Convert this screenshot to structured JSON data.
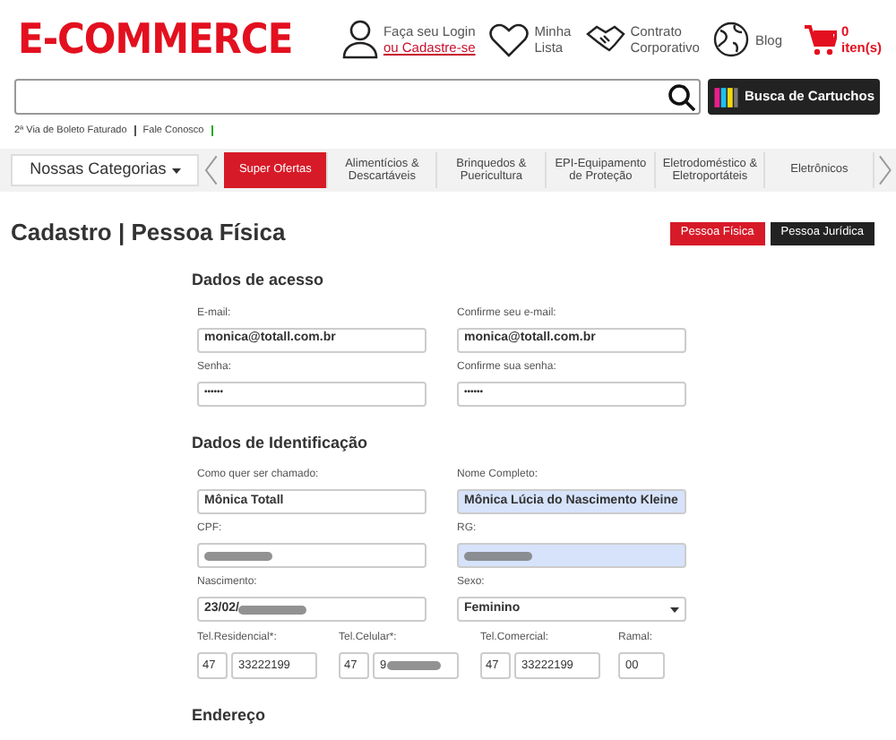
{
  "header": {
    "logo": "E-COMMERCE",
    "links": [
      {
        "kind": "login",
        "line1": "Faça seu Login",
        "line2": "ou Cadastre-se"
      },
      {
        "kind": "wishlist",
        "line1": "Minha",
        "line2": "Lista"
      },
      {
        "kind": "contract",
        "line1": "Contrato",
        "line2": "Corporativo"
      },
      {
        "kind": "blog",
        "line1": "Blog"
      }
    ],
    "cart": {
      "count": "0",
      "label": "iten(s)"
    }
  },
  "search": {
    "button": "Busca de Cartuchos"
  },
  "top_links": [
    "2ª Via de Boleto Faturado",
    "Fale Conosco"
  ],
  "nav": {
    "categories_button": "Nossas Categorias",
    "categories": [
      {
        "label": "Super Ofertas",
        "selected": true
      },
      {
        "label": "Alimentícios & Descartáveis",
        "selected": false
      },
      {
        "label": "Brinquedos & Puericultura",
        "selected": false
      },
      {
        "label": "EPI-Equipamento de Proteção",
        "selected": false
      },
      {
        "label": "Eletrodoméstico & Eletroportáteis",
        "selected": false
      },
      {
        "label": "Eletrônicos",
        "selected": false
      }
    ]
  },
  "page_title": "Cadastro | Pessoa Física",
  "person_types": [
    {
      "label": "Pessoa Física",
      "selected": true
    },
    {
      "label": "Pessoa Jurídica",
      "selected": false
    }
  ],
  "sections": [
    {
      "title": "Dados de acesso",
      "fields": [
        {
          "kind": "text",
          "label": "E-mail:",
          "value": "monica@totall.com.br",
          "autofilled": false,
          "redacted": false
        },
        {
          "kind": "text",
          "label": "Confirme seu e-mail:",
          "value": "monica@totall.com.br",
          "autofilled": false,
          "redacted": false
        },
        {
          "kind": "password",
          "label": "Senha:",
          "value": "••••••",
          "autofilled": false,
          "redacted": false
        },
        {
          "kind": "password",
          "label": "Confirme sua senha:",
          "value": "••••••",
          "autofilled": false,
          "redacted": false
        }
      ]
    },
    {
      "title": "Dados de Identificação",
      "fields": [
        {
          "kind": "text",
          "label": "Como quer ser chamado:",
          "value": "Mônica Totall",
          "autofilled": false,
          "redacted": false
        },
        {
          "kind": "text",
          "label": "Nome Completo:",
          "value": "Mônica Lúcia do Nascimento Kleine",
          "autofilled": true,
          "redacted": false
        },
        {
          "kind": "text",
          "label": "CPF:",
          "autofilled": false,
          "redacted": true
        },
        {
          "kind": "text",
          "label": "RG:",
          "autofilled": true,
          "redacted": true
        },
        {
          "kind": "text",
          "label": "Nascimento:",
          "value": "23/02/",
          "autofilled": false,
          "redacted": true
        },
        {
          "kind": "select",
          "label": "Sexo:",
          "value": "Feminino",
          "autofilled": false,
          "redacted": false
        }
      ],
      "phones": [
        {
          "label": "Tel.Residencial*:",
          "ddd": "47",
          "number": "33222199",
          "redacted": false
        },
        {
          "label": "Tel.Celular*:",
          "ddd": "47",
          "number": "9",
          "redacted": true
        },
        {
          "label": "Tel.Comercial:",
          "ddd": "47",
          "number": "33222199",
          "redacted": false
        }
      ],
      "extension": {
        "label": "Ramal:",
        "value": "00"
      }
    },
    {
      "title": "Endereço"
    }
  ]
}
